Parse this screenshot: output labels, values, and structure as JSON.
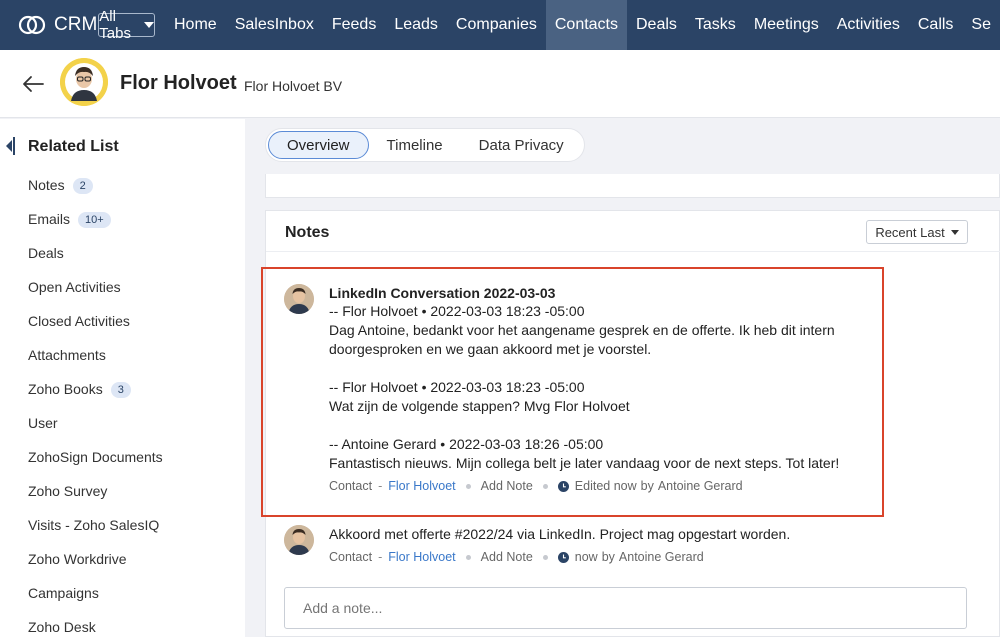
{
  "nav": {
    "brand": "CRM",
    "all_tabs": "All Tabs",
    "tabs": [
      "Home",
      "SalesInbox",
      "Feeds",
      "Leads",
      "Companies",
      "Contacts",
      "Deals",
      "Tasks",
      "Meetings",
      "Activities",
      "Calls",
      "Se"
    ],
    "active_tab": "Contacts",
    "colors": {
      "bar": "#2b4466",
      "active": "#4a6282"
    }
  },
  "header": {
    "name": "Flor Holvoet",
    "separator": "-",
    "company": "Flor Holvoet BV",
    "avatar_icon": "person-avatar"
  },
  "sidebar": {
    "title": "Related List",
    "items": [
      {
        "label": "Notes",
        "badge": "2"
      },
      {
        "label": "Emails",
        "badge": "10+"
      },
      {
        "label": "Deals"
      },
      {
        "label": "Open Activities"
      },
      {
        "label": "Closed Activities"
      },
      {
        "label": "Attachments"
      },
      {
        "label": "Zoho Books",
        "badge": "3"
      },
      {
        "label": "User"
      },
      {
        "label": "ZohoSign Documents"
      },
      {
        "label": "Zoho Survey"
      },
      {
        "label": "Visits - Zoho SalesIQ"
      },
      {
        "label": "Zoho Workdrive"
      },
      {
        "label": "Campaigns"
      },
      {
        "label": "Zoho Desk"
      }
    ]
  },
  "tabs": {
    "items": [
      "Overview",
      "Timeline",
      "Data Privacy"
    ],
    "active": "Overview"
  },
  "notes": {
    "title": "Notes",
    "sort_label": "Recent Last",
    "items": [
      {
        "title": "LinkedIn Conversation 2022-03-03",
        "lines": [
          "-- Flor Holvoet • 2022-03-03 18:23 -05:00",
          "Dag Antoine, bedankt voor het aangename gesprek en de offerte. Ik heb dit intern",
          "doorgesproken en we gaan akkoord met je voorstel.",
          "",
          "-- Flor Holvoet • 2022-03-03 18:23 -05:00",
          "Wat zijn de volgende stappen? Mvg Flor Holvoet",
          "",
          "-- Antoine Gerard • 2022-03-03 18:26 -05:00",
          "Fantastisch nieuws. Mijn collega belt je later vandaag voor de next steps. Tot later!"
        ],
        "meta": {
          "module": "Contact",
          "dash": "-",
          "record": "Flor Holvoet",
          "add_note": "Add Note",
          "time": "Edited now",
          "by": "by",
          "author": "Antoine Gerard"
        }
      },
      {
        "title": "",
        "lines": [
          "Akkoord met offerte #2022/24 via LinkedIn. Project mag opgestart worden."
        ],
        "meta": {
          "module": "Contact",
          "dash": "-",
          "record": "Flor Holvoet",
          "add_note": "Add Note",
          "time": "now",
          "by": "by",
          "author": "Antoine Gerard"
        }
      }
    ],
    "add_placeholder": "Add a note..."
  },
  "highlight_color": "#d9442b"
}
